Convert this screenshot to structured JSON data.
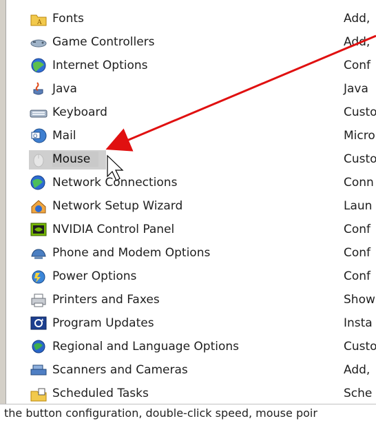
{
  "items": [
    {
      "name": "Fonts",
      "desc": "Add,",
      "icon": "folder-icon"
    },
    {
      "name": "Game Controllers",
      "desc": "Add,",
      "icon": "game-controller-icon"
    },
    {
      "name": "Internet Options",
      "desc": "Conf",
      "icon": "globe-icon"
    },
    {
      "name": "Java",
      "desc": "Java",
      "icon": "java-cup-icon"
    },
    {
      "name": "Keyboard",
      "desc": "Custo",
      "icon": "keyboard-icon"
    },
    {
      "name": "Mail",
      "desc": "Micro",
      "icon": "mail-icon"
    },
    {
      "name": "Mouse",
      "desc": "Custo",
      "icon": "mouse-icon",
      "selected": true
    },
    {
      "name": "Network Connections",
      "desc": "Conn",
      "icon": "network-icon"
    },
    {
      "name": "Network Setup Wizard",
      "desc": "Laun",
      "icon": "network-wizard-icon"
    },
    {
      "name": "NVIDIA Control Panel",
      "desc": "Conf",
      "icon": "nvidia-icon"
    },
    {
      "name": "Phone and Modem Options",
      "desc": "Conf",
      "icon": "phone-icon"
    },
    {
      "name": "Power Options",
      "desc": "Conf",
      "icon": "power-icon"
    },
    {
      "name": "Printers and Faxes",
      "desc": "Show",
      "icon": "printer-icon"
    },
    {
      "name": "Program Updates",
      "desc": "Insta",
      "icon": "updates-icon"
    },
    {
      "name": "Regional and Language Options",
      "desc": "Custo",
      "icon": "regional-globe-icon"
    },
    {
      "name": "Scanners and Cameras",
      "desc": "Add,",
      "icon": "scanner-icon"
    },
    {
      "name": "Scheduled Tasks",
      "desc": "Sche",
      "icon": "scheduled-tasks-icon"
    }
  ],
  "status_bar": {
    "text": "the button configuration, double-click speed, mouse poir"
  },
  "colors": {
    "annotation_arrow": "#e01010",
    "selection": "#cfcfcf"
  }
}
